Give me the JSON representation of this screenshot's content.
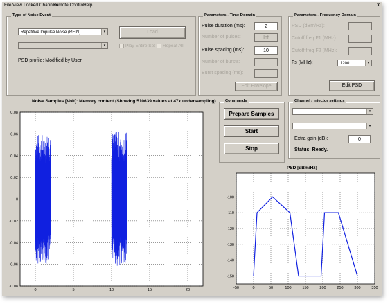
{
  "menu": [
    "File",
    "View",
    "Locked Channels",
    "Remote Control",
    "Help"
  ],
  "close_glyph": "x",
  "noise_event": {
    "title": "Type of Noise Event",
    "noise_type": "Repetitive Impulse Noise (REIN)",
    "secondary_select": "",
    "load_label": "Load",
    "play_entire_set": "Play Entire Set",
    "repeat_all": "Repeat All",
    "psd_profile": "PSD profile: Modified by User"
  },
  "time_domain": {
    "title": "Parameters - Time Domain",
    "pulse_duration_label": "Pulse duration (ms):",
    "pulse_duration_value": "2",
    "num_pulses_label": "Number of pulses:",
    "num_pulses_value": "Inf",
    "pulse_spacing_label": "Pulse spacing (ms):",
    "pulse_spacing_value": "10",
    "num_bursts_label": "Number of bursts:",
    "burst_spacing_label": "Burst spacing (ms):",
    "edit_envelope_label": "Edit Envelope"
  },
  "freq_domain": {
    "title": "Parameters - Frequency Domain",
    "psd_label": "PSD (dBm/Hz):",
    "cutoff_f1_label": "Cutoff freq F1 (MHz):",
    "cutoff_f2_label": "Cutoff freq F2 (MHz):",
    "fs_label": "Fs (MHz):",
    "fs_value": "1200",
    "edit_psd_label": "Edit PSD"
  },
  "commands": {
    "title": "Commands",
    "prepare_label": "Prepare Samples",
    "start_label": "Start",
    "stop_label": "Stop"
  },
  "channel": {
    "title": "Channel / Injector settings",
    "select1": "",
    "select2": "",
    "extra_gain_label": "Extra gain (dB):",
    "extra_gain_value": "0",
    "status": "Status: Ready."
  },
  "chart_data": [
    {
      "type": "line",
      "title": "Noise Samples [Volt]:  Memory content  (Showing 510639 values at 47x undersampling)",
      "xlabel": "",
      "ylabel": "",
      "xlim": [
        -2,
        22
      ],
      "ylim": [
        -0.08,
        0.08
      ],
      "x_ticks": [
        "0",
        "5",
        "10",
        "15",
        "20"
      ],
      "y_ticks": [
        "0.08",
        "0.06",
        "0.04",
        "0.02",
        "0",
        "-0.02",
        "-0.04",
        "-0.06",
        "-0.08"
      ],
      "grid": true,
      "color": "#1020e0",
      "bursts": [
        {
          "x_start": 0,
          "x_end": 2,
          "amplitude": 0.06
        },
        {
          "x_start": 10,
          "x_end": 12,
          "amplitude": 0.062
        }
      ],
      "baseline": 0
    },
    {
      "type": "line",
      "title": "PSD [dBm/Hz]",
      "xlim": [
        -50,
        350
      ],
      "ylim": [
        -155,
        -85
      ],
      "x_ticks": [
        "-50",
        "0",
        "50",
        "100",
        "150",
        "200",
        "250",
        "300",
        "350"
      ],
      "y_ticks": [
        "-100",
        "-110",
        "-120",
        "-130",
        "-140",
        "-150"
      ],
      "grid": true,
      "color": "#1020e0",
      "x": [
        0,
        10,
        55,
        105,
        130,
        195,
        205,
        245,
        300
      ],
      "y": [
        -150,
        -110,
        -100,
        -110,
        -150,
        -150,
        -110,
        -110,
        -150
      ]
    }
  ]
}
